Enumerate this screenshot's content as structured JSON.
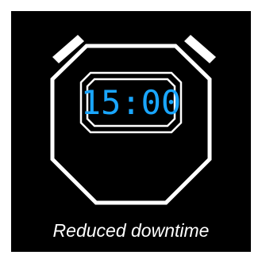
{
  "display": {
    "time": "15:00"
  },
  "caption": {
    "text": "Reduced downtime"
  },
  "colors": {
    "background": "#000000",
    "outline": "#ffffff",
    "digits": "#1aa6ff"
  },
  "icons": {
    "illustration": "stopwatch-icon"
  }
}
